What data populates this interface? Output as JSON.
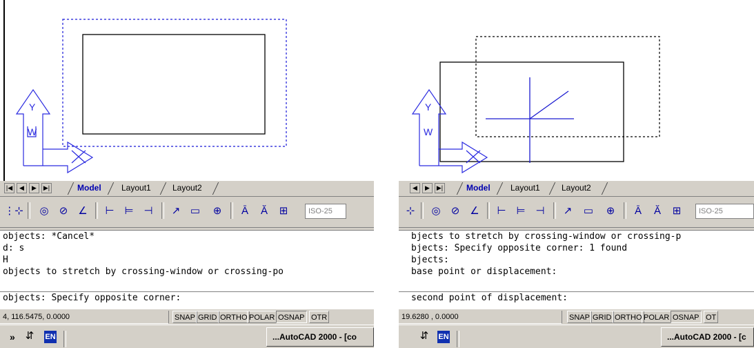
{
  "left": {
    "tabs": {
      "model": "Model",
      "layout1": "Layout1",
      "layout2": "Layout2"
    },
    "dimstyle": "ISO-25",
    "command_history": [
      " objects: *Cancel*",
      "d: s",
      "H",
      " objects to stretch by crossing-window or crossing-po"
    ],
    "command_prompt": " objects: Specify opposite corner:",
    "coords": "4, 116.5475, 0.0000",
    "status_buttons": [
      "SNAP",
      "GRID",
      "ORTHO",
      "POLAR",
      "OSNAP",
      "OTR"
    ],
    "ucs": {
      "y_label": "Y",
      "w_label": "W"
    },
    "taskbar": {
      "chevron": "»",
      "lang": "EN",
      "app_button": "...AutoCAD 2000 - [co"
    }
  },
  "right": {
    "tabs": {
      "model": "Model",
      "layout1": "Layout1",
      "layout2": "Layout2"
    },
    "dimstyle": "ISO-25",
    "command_history": [
      "bjects to stretch by crossing-window or crossing-p",
      "bjects: Specify opposite corner: 1 found",
      "bjects:",
      "base point or displacement:"
    ],
    "command_prompt": "second point of displacement:",
    "coords": "19.6280 , 0.0000",
    "status_buttons": [
      "SNAP",
      "GRID",
      "ORTHO",
      "POLAR",
      "OSNAP",
      "OT"
    ],
    "ucs": {
      "y_label": "Y",
      "w_label": "W"
    },
    "taskbar": {
      "lang": "EN",
      "app_button": "...AutoCAD 2000 - [c"
    }
  },
  "colors": {
    "ucs_blue": "#2a2ae0",
    "selection_dash": "#1818d8",
    "crosshair": "#1a1ad0",
    "chrome": "#d4d0c8"
  },
  "icons": [
    "first-tab-icon",
    "prev-tab-icon",
    "next-tab-icon",
    "last-tab-icon",
    "dim-ordinate-icon",
    "dim-radius-icon",
    "dim-diameter-icon",
    "dim-angular-icon",
    "dim-quick-icon",
    "dim-baseline-icon",
    "dim-continue-icon",
    "leader-icon",
    "tolerance-icon",
    "center-mark-icon",
    "dim-edit-icon",
    "dim-text-edit-icon",
    "dim-update-icon",
    "language-icon"
  ]
}
